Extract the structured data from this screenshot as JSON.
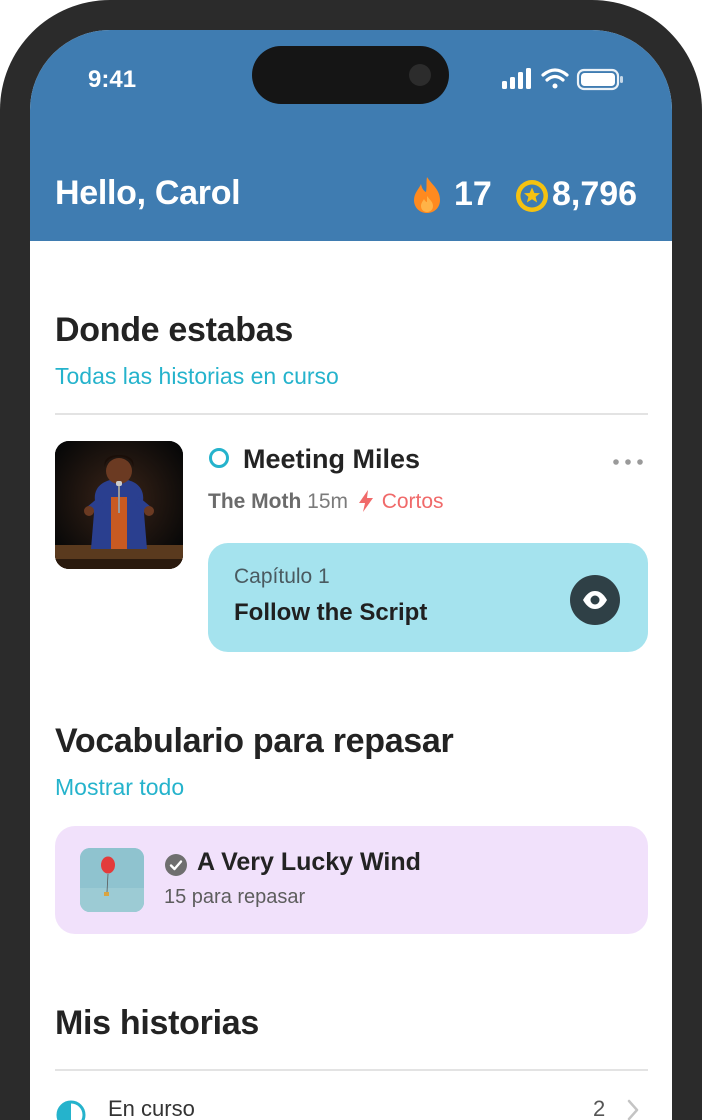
{
  "status_bar": {
    "time": "9:41",
    "icons": [
      "signal-icon",
      "wifi-icon",
      "battery-icon"
    ]
  },
  "header": {
    "greeting": "Hello, Carol",
    "streak": "17",
    "points": "8,796",
    "background": "#3f7cb1",
    "icons": [
      "flame-icon",
      "star-coin-icon"
    ]
  },
  "continue_section": {
    "title": "Donde estabas",
    "link": "Todas las historias en curso",
    "story": {
      "title": "Meeting Miles",
      "source": "The Moth",
      "duration": "15m",
      "tag": "Cortos",
      "chapter_label": "Capítulo 1",
      "chapter_title": "Follow the Script",
      "icons": [
        "status-ring-icon",
        "more-options-icon",
        "bolt-icon",
        "eye-icon"
      ]
    }
  },
  "vocab_section": {
    "title": "Vocabulario para repasar",
    "link": "Mostrar todo",
    "item": {
      "title": "A Very Lucky Wind",
      "subtitle": "15 para repasar",
      "icons": [
        "check-circle-icon"
      ]
    }
  },
  "stories_section": {
    "title": "Mis historias",
    "rows": [
      {
        "label": "En curso",
        "count": "2",
        "icons": [
          "half-circle-icon",
          "chevron-right-icon"
        ]
      }
    ]
  },
  "colors": {
    "accent": "#25b3cc",
    "chapter_card": "#a5e3ee",
    "vocab_card": "#f1e1fb",
    "tag": "#f06a6a",
    "streak": "#ff8a1f",
    "points": "#f5c211"
  }
}
